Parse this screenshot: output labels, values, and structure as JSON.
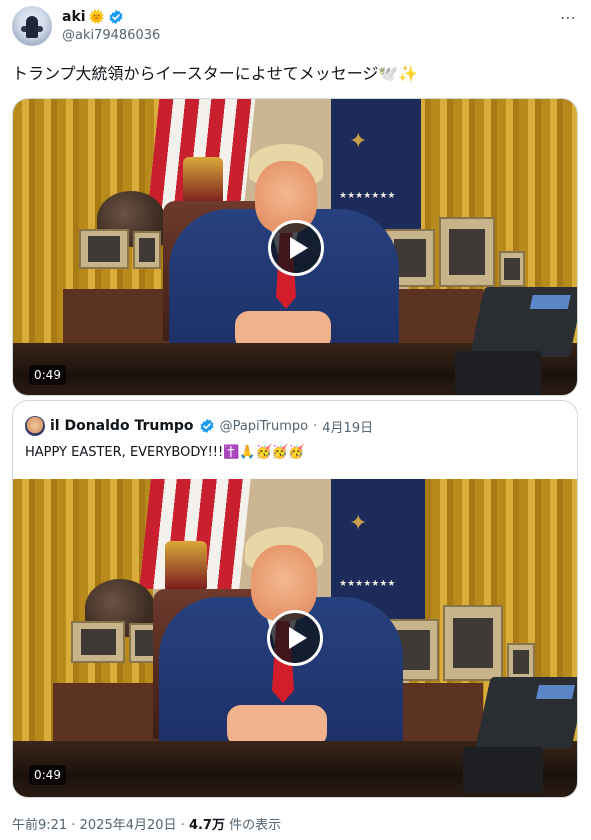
{
  "author": {
    "name": "aki",
    "name_emoji": "🌞",
    "handle": "@aki79486036",
    "avatar_icon": "avatar-icon",
    "verified": true
  },
  "more_label": "⋯",
  "tweet": {
    "text": "トランプ大統領からイースターによせてメッセージ",
    "emojis": "🕊️✨"
  },
  "video_main": {
    "duration": "0:49",
    "play_icon": "play-icon"
  },
  "quote": {
    "name": "il Donaldo Trumpo",
    "handle": "@PapiTrumpo",
    "separator": "·",
    "date": "4月19日",
    "text": "HAPPY EASTER, EVERYBODY!!!",
    "emojis": "✝️🙏🥳🥳🥳",
    "video": {
      "duration": "0:49",
      "play_icon": "play-icon"
    }
  },
  "footer": {
    "time": "午前9:21",
    "date": "2025年4月20日",
    "views": "4.7万",
    "views_label": "件の表示",
    "dot": "·"
  },
  "colors": {
    "verified_blue": "#1d9bf0",
    "muted": "#536471",
    "text": "#0f1419",
    "border": "#cfd9de"
  }
}
